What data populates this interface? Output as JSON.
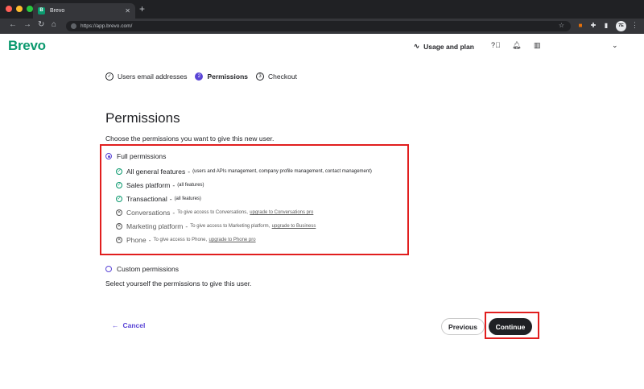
{
  "browser": {
    "tab_title": "Brevo",
    "tab_favicon": "B",
    "url": "https://app.brevo.com/",
    "profile_initials": "7E"
  },
  "header": {
    "logo": "Brevo",
    "usage_label": "Usage and plan"
  },
  "stepper": {
    "steps": [
      {
        "badge": "✓",
        "label": "Users email addresses"
      },
      {
        "badge": "2",
        "label": "Permissions"
      },
      {
        "badge": "3",
        "label": "Checkout"
      }
    ]
  },
  "main": {
    "title": "Permissions",
    "subtitle": "Choose the permissions you want to give this new user.",
    "full_label": "Full permissions",
    "custom_label": "Custom permissions",
    "custom_note": "Select yourself the permissions to give this user.",
    "permissions": [
      {
        "name": "All general features",
        "note": "(users and APIs management, company profile management, contact management)",
        "link": "",
        "status": "check"
      },
      {
        "name": "Sales platform",
        "note": "(all features)",
        "link": "",
        "status": "check"
      },
      {
        "name": "Transactional",
        "note": "(all features)",
        "link": "",
        "status": "check"
      },
      {
        "name": "Conversations",
        "note": "To give access to Conversations,",
        "link": "upgrade to Conversations pro",
        "status": "x"
      },
      {
        "name": "Marketing platform",
        "note": "To give access to Marketing platform,",
        "link": "upgrade to Business",
        "status": "x"
      },
      {
        "name": "Phone",
        "note": "To give access to Phone,",
        "link": "upgrade to Phone pro",
        "status": "x"
      }
    ]
  },
  "footer": {
    "cancel_label": "Cancel",
    "previous_label": "Previous",
    "continue_label": "Continue"
  },
  "colors": {
    "brand": "#0b996e",
    "accent": "#5a45d6",
    "highlight": "#e11e1e",
    "dark": "#1f2024"
  }
}
